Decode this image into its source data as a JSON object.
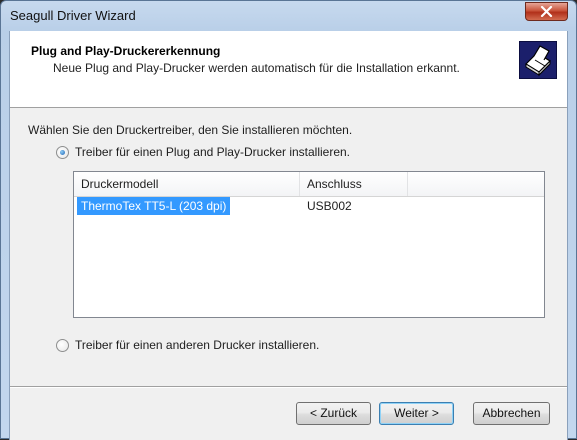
{
  "window": {
    "title": "Seagull Driver Wizard"
  },
  "header": {
    "title": "Plug and Play-Druckererkennung",
    "subtitle": "Neue Plug and Play-Drucker werden automatisch für die Installation erkannt.",
    "icon": "printer-icon"
  },
  "instruction": "Wählen Sie den Druckertreiber, den Sie installieren möchten.",
  "options": {
    "pnp_label": "Treiber für einen Plug and Play-Drucker installieren.",
    "other_label": "Treiber für einen anderen Drucker installieren.",
    "selected": "pnp"
  },
  "printer_list": {
    "columns": [
      "Druckermodell",
      "Anschluss",
      ""
    ],
    "rows": [
      {
        "model": "ThermoTex TT5-L (203 dpi)",
        "port": "USB002",
        "selected": true
      }
    ]
  },
  "buttons": {
    "back": "< Zurück",
    "next": "Weiter >",
    "cancel": "Abbrechen"
  },
  "colors": {
    "selection": "#3399ff",
    "close_button": "#c9543b"
  }
}
